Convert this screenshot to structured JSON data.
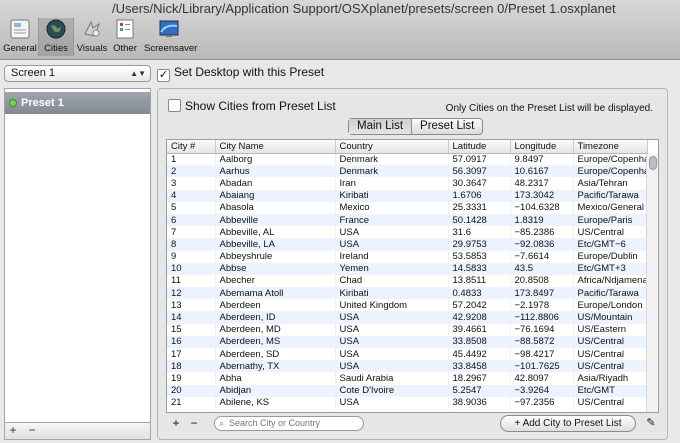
{
  "window": {
    "title": "/Users/Nick/Library/Application Support/OSXplanet/presets/screen 0/Preset 1.osxplanet"
  },
  "toolbar": {
    "items": [
      {
        "label": "General",
        "icon": "general-icon"
      },
      {
        "label": "Cities",
        "icon": "globe-icon"
      },
      {
        "label": "Visuals",
        "icon": "visuals-icon"
      },
      {
        "label": "Other",
        "icon": "other-icon"
      },
      {
        "label": "Screensaver",
        "icon": "screensaver-icon"
      }
    ],
    "active": "Cities"
  },
  "screen_select": {
    "value": "Screen 1"
  },
  "set_desktop": {
    "label": "Set Desktop with this Preset",
    "checked": true
  },
  "sidebar": {
    "presets": [
      {
        "label": "Preset 1",
        "status_color": "#6fd64a"
      }
    ],
    "add_label": "+",
    "remove_label": "−"
  },
  "main": {
    "show_cities_label": "Show Cities from Preset List",
    "show_cities_checked": false,
    "note": "Only Cities on the Preset List will be displayed.",
    "tabs": [
      "Main List",
      "Preset List"
    ],
    "selected_tab": "Main List",
    "table": {
      "columns": [
        "City #",
        "City Name",
        "Country",
        "Latitude",
        "Longitude",
        "Timezone"
      ],
      "rows": [
        [
          "1",
          "Aalborg",
          "Denmark",
          "57.0917",
          "9.8497",
          "Europe/Copenhagen"
        ],
        [
          "2",
          "Aarhus",
          "Denmark",
          "56.3097",
          "10.6167",
          "Europe/Copenhagen"
        ],
        [
          "3",
          "Abadan",
          "Iran",
          "30.3647",
          "48.2317",
          "Asia/Tehran"
        ],
        [
          "4",
          "Abaiang",
          "Kiribati",
          "1.6706",
          "173.3042",
          "Pacific/Tarawa"
        ],
        [
          "5",
          "Abasola",
          "Mexico",
          "25.3331",
          "−104.6328",
          "Mexico/General"
        ],
        [
          "6",
          "Abbeville",
          "France",
          "50.1428",
          "1.8319",
          "Europe/Paris"
        ],
        [
          "7",
          "Abbeville, AL",
          "USA",
          "31.6",
          "−85.2386",
          "US/Central"
        ],
        [
          "8",
          "Abbeville, LA",
          "USA",
          "29.9753",
          "−92.0836",
          "Etc/GMT−6"
        ],
        [
          "9",
          "Abbeyshrule",
          "Ireland",
          "53.5853",
          "−7.6614",
          "Europe/Dublin"
        ],
        [
          "10",
          "Abbse",
          "Yemen",
          "14.5833",
          "43.5",
          "Etc/GMT+3"
        ],
        [
          "11",
          "Abecher",
          "Chad",
          "13.8511",
          "20.8508",
          "Africa/Ndjamena"
        ],
        [
          "12",
          "Abemama Atoll",
          "Kiribati",
          "0.4833",
          "173.8497",
          "Pacific/Tarawa"
        ],
        [
          "13",
          "Aberdeen",
          "United Kingdom",
          "57.2042",
          "−2.1978",
          "Europe/London"
        ],
        [
          "14",
          "Aberdeen, ID",
          "USA",
          "42.9208",
          "−112.8806",
          "US/Mountain"
        ],
        [
          "15",
          "Aberdeen, MD",
          "USA",
          "39.4661",
          "−76.1694",
          "US/Eastern"
        ],
        [
          "16",
          "Aberdeen, MS",
          "USA",
          "33.8508",
          "−88.5872",
          "US/Central"
        ],
        [
          "17",
          "Aberdeen, SD",
          "USA",
          "45.4492",
          "−98.4217",
          "US/Central"
        ],
        [
          "18",
          "Abernathy, TX",
          "USA",
          "33.8458",
          "−101.7625",
          "US/Central"
        ],
        [
          "19",
          "Abha",
          "Saudi Arabia",
          "18.2967",
          "42.8097",
          "Asia/Riyadh"
        ],
        [
          "20",
          "Abidjan",
          "Cote D'Ivoire",
          "5.2547",
          "−3.9264",
          "Etc/GMT"
        ],
        [
          "21",
          "Abilene, KS",
          "USA",
          "38.9036",
          "−97.2356",
          "US/Central"
        ]
      ]
    },
    "search": {
      "placeholder": "Search City or Country"
    },
    "add_button": "+",
    "remove_button": "−",
    "add_to_preset_label": "+ Add City to Preset List"
  }
}
